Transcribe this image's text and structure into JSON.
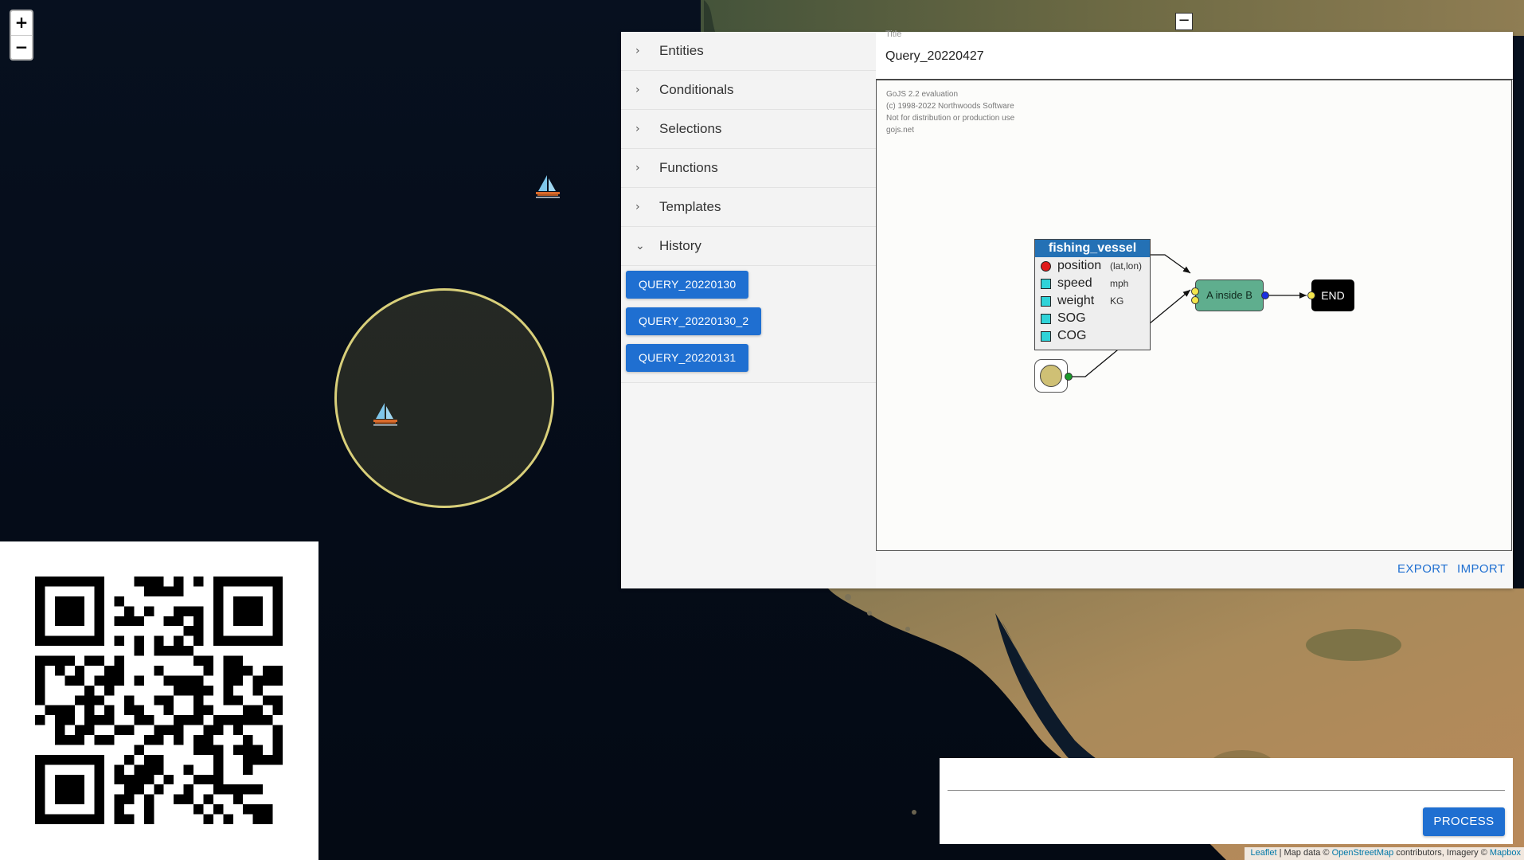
{
  "map": {
    "zoom_in": "+",
    "zoom_out": "−",
    "attribution": {
      "leaflet": "Leaflet",
      "sep1": " | Map data © ",
      "osm": "OpenStreetMap",
      "mid": " contributors, Imagery © ",
      "mapbox": "Mapbox"
    }
  },
  "sidebar": {
    "items": [
      {
        "label": "Entities",
        "chevron": "›"
      },
      {
        "label": "Conditionals",
        "chevron": "›"
      },
      {
        "label": "Selections",
        "chevron": "›"
      },
      {
        "label": "Functions",
        "chevron": "›"
      },
      {
        "label": "Templates",
        "chevron": "›"
      },
      {
        "label": "History",
        "chevron": "⌄"
      }
    ],
    "history": [
      "QUERY_20220130",
      "QUERY_20220130_2",
      "QUERY_20220131"
    ]
  },
  "editor": {
    "title_label": "Title",
    "title_value": "Query_20220427",
    "evaluation": [
      "GoJS 2.2 evaluation",
      "(c) 1998-2022 Northwoods Software",
      "Not for distribution or production use",
      "gojs.net"
    ],
    "entity": {
      "name": "fishing_vessel",
      "attributes": [
        {
          "name": "position",
          "unit": "(lat,lon)",
          "port": "red-circle"
        },
        {
          "name": "speed",
          "unit": "mph",
          "port": "cyan-square"
        },
        {
          "name": "weight",
          "unit": "KG",
          "port": "cyan-square"
        },
        {
          "name": "SOG",
          "unit": "",
          "port": "cyan-square"
        },
        {
          "name": "COG",
          "unit": "",
          "port": "cyan-square"
        }
      ]
    },
    "operator": "A inside B",
    "end": "END",
    "export": "EXPORT",
    "import": "IMPORT",
    "collapse": "−"
  },
  "process": {
    "input_value": "",
    "button": "PROCESS"
  },
  "colors": {
    "accent": "#1f6fd1",
    "entity_header": "#2471b5",
    "operator": "#5fae8e",
    "geofence": "#d8cf7a"
  }
}
